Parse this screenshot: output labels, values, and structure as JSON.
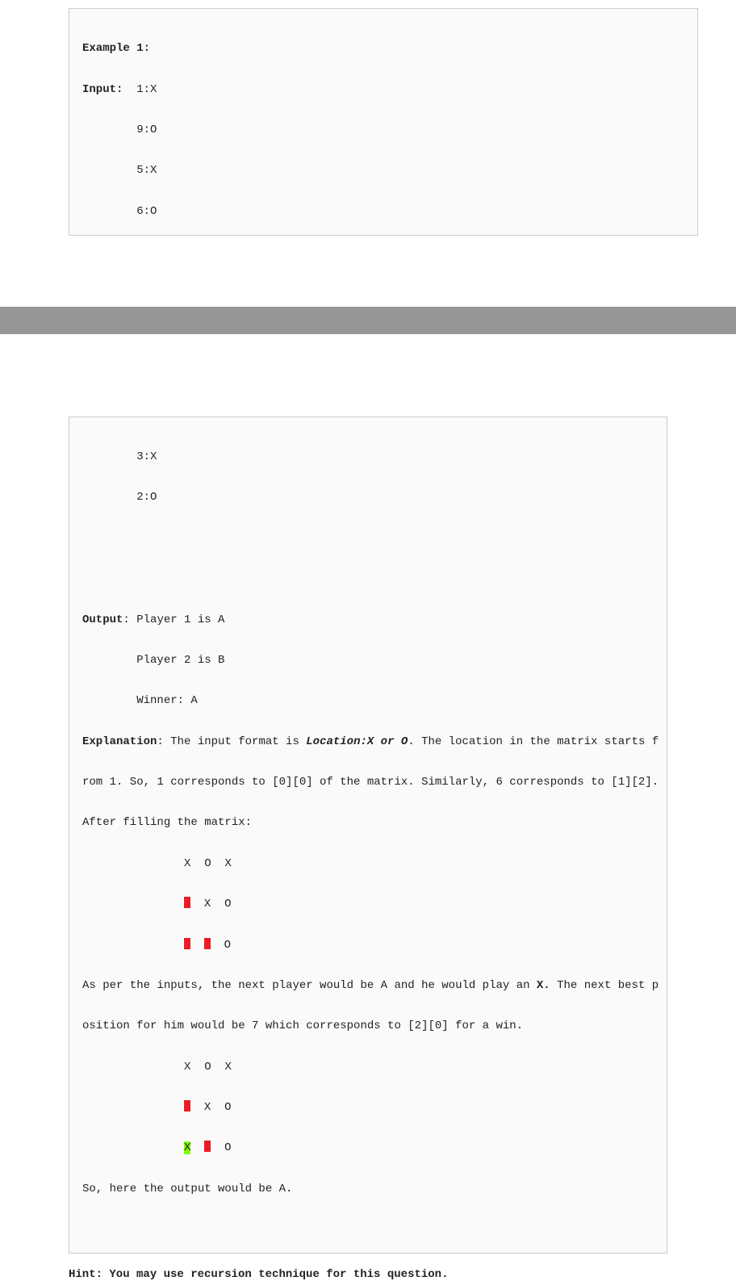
{
  "top": {
    "example_label": "Example 1:",
    "input_label": "Input:",
    "input_lines": [
      "1:X",
      "9:O",
      "5:X",
      "6:O"
    ]
  },
  "bottom": {
    "cont_lines": [
      "3:X",
      "2:O"
    ],
    "output_label": "Output",
    "output_lines": [
      "Player 1 is A",
      "Player 2 is B",
      "Winner: A"
    ],
    "explanation_label": "Explanation",
    "exp_pre": "The input format is ",
    "exp_loc_fmt": "Location:X or O",
    "exp_post1": ". The location in the matrix starts f",
    "exp_post2": "rom 1. So, 1 corresponds to [0][0] of the matrix. Similarly, 6 corresponds to [1][2].",
    "exp_post3": "After filling the matrix:",
    "matrix1": {
      "r1": {
        "a": "X",
        "b": "O",
        "c": "X"
      },
      "r2": {
        "b": "X",
        "c": "O"
      },
      "r3": {
        "c": "O"
      }
    },
    "mid1": "As per the inputs, the next player would be A and he would play an ",
    "mid_x": "X.",
    "mid2": " The next best p",
    "mid3": "osition for him would be 7 which corresponds to [2][0] for a win.",
    "matrix2": {
      "r1": {
        "a": "X",
        "b": "O",
        "c": "X"
      },
      "r2": {
        "b": "X",
        "c": "O"
      },
      "r3": {
        "a": "X",
        "c": "O"
      }
    },
    "closing": "So, here the output would be A."
  },
  "hint": "Hint: You may use recursion technique for this question."
}
